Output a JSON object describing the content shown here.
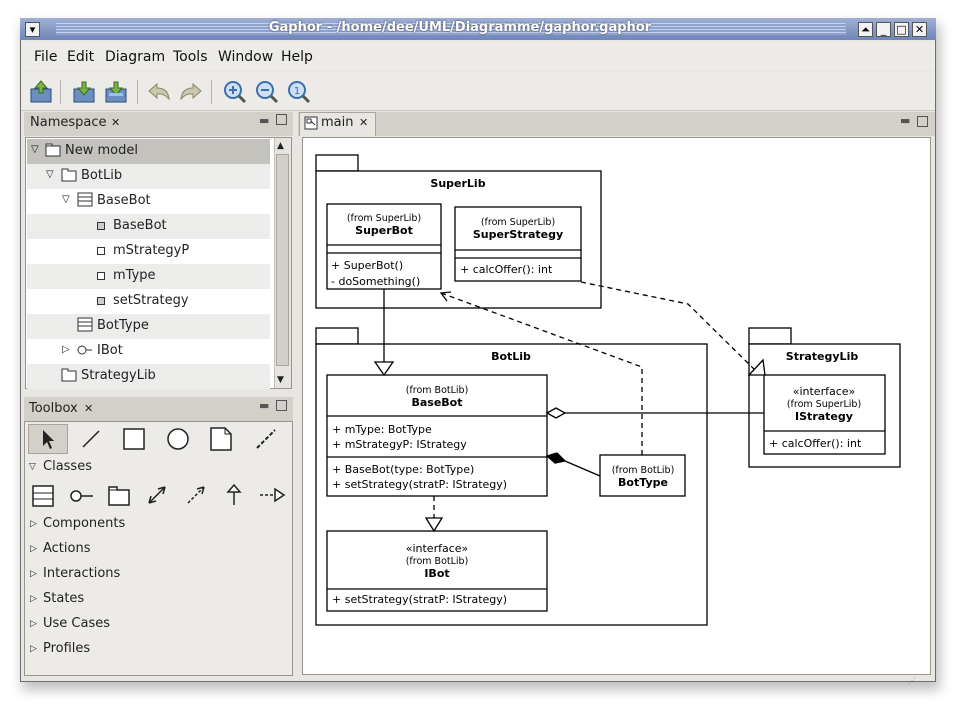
{
  "window": {
    "title": "Gaphor - /home/dee/UML/Diagramme/gaphor.gaphor"
  },
  "menubar": {
    "items": [
      {
        "label": "File"
      },
      {
        "label": "Edit"
      },
      {
        "label": "Diagram"
      },
      {
        "label": "Tools"
      },
      {
        "label": "Window"
      },
      {
        "label": "Help"
      }
    ]
  },
  "toolbar": {
    "icons": [
      "open-icon",
      "save-icon",
      "save-as-icon",
      "undo-icon",
      "redo-icon",
      "zoom-in-icon",
      "zoom-out-icon",
      "zoom-100-icon"
    ]
  },
  "namespace": {
    "tab": "Namespace",
    "items": [
      {
        "label": "New model"
      },
      {
        "label": "BotLib"
      },
      {
        "label": "BaseBot"
      },
      {
        "label": "BaseBot"
      },
      {
        "label": "mStrategyP"
      },
      {
        "label": "mType"
      },
      {
        "label": "setStrategy"
      },
      {
        "label": "BotType"
      },
      {
        "label": "IBot"
      },
      {
        "label": "StrategyLib"
      }
    ]
  },
  "toolbox": {
    "tab": "Toolbox",
    "sections": [
      {
        "label": "Classes"
      },
      {
        "label": "Components"
      },
      {
        "label": "Actions"
      },
      {
        "label": "Interactions"
      },
      {
        "label": "States"
      },
      {
        "label": "Use Cases"
      },
      {
        "label": "Profiles"
      }
    ]
  },
  "diagram": {
    "tab": "main",
    "packages": {
      "superlib": "SuperLib",
      "botlib": "BotLib",
      "strategylib": "StrategyLib"
    },
    "superbot": {
      "from": "(from SuperLib)",
      "name": "SuperBot",
      "ops": [
        "+ SuperBot()",
        "- doSomething()"
      ]
    },
    "superstrategy": {
      "from": "(from SuperLib)",
      "name": "SuperStrategy",
      "ops": [
        "+ calcOffer(): int"
      ]
    },
    "basebot": {
      "from": "(from BotLib)",
      "name": "BaseBot",
      "attrs": [
        "+ mType: BotType",
        "+ mStrategyP: IStrategy"
      ],
      "ops": [
        "+ BaseBot(type: BotType)",
        "+ setStrategy(stratP: IStrategy)"
      ]
    },
    "bottype": {
      "from": "(from BotLib)",
      "name": "BotType"
    },
    "ibot": {
      "stereotype": "«interface»",
      "from": "(from BotLib)",
      "name": "IBot",
      "ops": [
        "+ setStrategy(stratP: IStrategy)"
      ]
    },
    "istrategy": {
      "stereotype": "«interface»",
      "from": "(from SuperLib)",
      "name": "IStrategy",
      "ops": [
        "+ calcOffer(): int"
      ]
    }
  }
}
